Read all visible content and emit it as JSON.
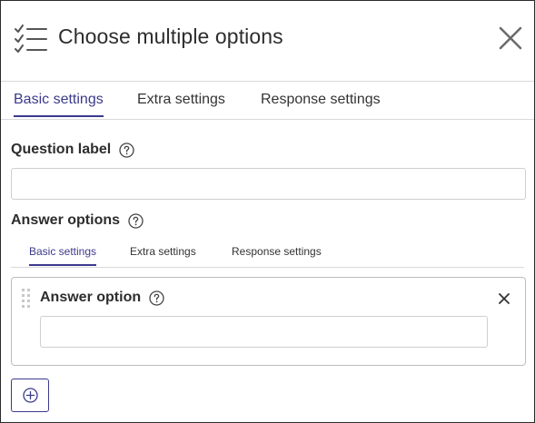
{
  "header": {
    "title": "Choose multiple options",
    "icon": "checklist-icon",
    "close_icon": "close-icon"
  },
  "tabs": [
    {
      "label": "Basic settings",
      "active": true
    },
    {
      "label": "Extra settings",
      "active": false
    },
    {
      "label": "Response settings",
      "active": false
    }
  ],
  "question_label": {
    "label": "Question label",
    "help_icon": "help-icon",
    "value": "",
    "placeholder": ""
  },
  "answer_options": {
    "label": "Answer options",
    "help_icon": "help-icon",
    "tabs": [
      {
        "label": "Basic settings",
        "active": true
      },
      {
        "label": "Extra settings",
        "active": false
      },
      {
        "label": "Response settings",
        "active": false
      }
    ],
    "option": {
      "label": "Answer option",
      "value": "",
      "placeholder": "",
      "drag_icon": "drag-handle-icon",
      "remove_icon": "close-icon"
    },
    "add_icon": "add-circle-icon"
  },
  "colors": {
    "accent": "#3a3a8c",
    "border": "#d9d9d9",
    "text": "#2d2d2d"
  }
}
